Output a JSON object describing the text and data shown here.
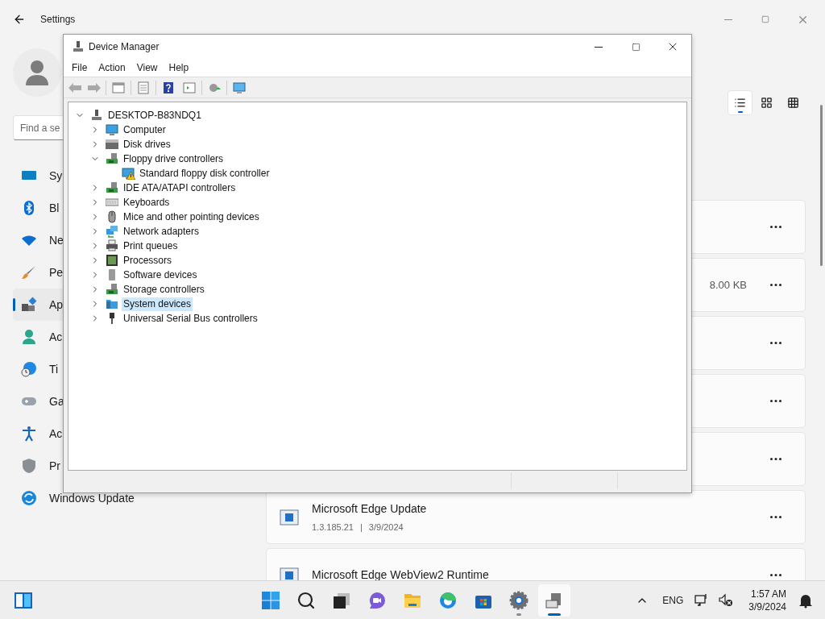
{
  "settings": {
    "title": "Settings",
    "search": {
      "placeholder": "Find a se"
    },
    "nav": [
      {
        "label": "Sy",
        "selected": false
      },
      {
        "label": "Bl",
        "selected": false
      },
      {
        "label": "Ne",
        "selected": false
      },
      {
        "label": "Pe",
        "selected": false
      },
      {
        "label": "Ap",
        "selected": true
      },
      {
        "label": "Ac",
        "selected": false
      },
      {
        "label": "Ti",
        "selected": false
      },
      {
        "label": "Ga",
        "selected": false
      },
      {
        "label": "Ac",
        "selected": false
      },
      {
        "label": "Pr",
        "selected": false
      },
      {
        "label": "Windows Update",
        "selected": false
      }
    ],
    "view_options": [
      {
        "selected": true
      },
      {
        "selected": false
      },
      {
        "selected": false
      }
    ],
    "cards": [
      {
        "kind": "hidden"
      },
      {
        "kind": "hidden",
        "size": "8.00 KB"
      },
      {
        "kind": "hidden"
      },
      {
        "kind": "hidden"
      },
      {
        "kind": "hidden"
      },
      {
        "kind": "app",
        "title": "Microsoft Edge Update",
        "version": "1.3.185.21",
        "separator": "|",
        "date": "3/9/2024"
      },
      {
        "kind": "app",
        "title": "Microsoft Edge WebView2 Runtime"
      }
    ]
  },
  "device_manager": {
    "title": "Device Manager",
    "menu": [
      "File",
      "Action",
      "View",
      "Help"
    ],
    "tree": {
      "label": "DESKTOP-B83NDQ1",
      "expanded": true,
      "selected": false,
      "children": [
        {
          "label": "Computer",
          "expanded": false,
          "selected": false
        },
        {
          "label": "Disk drives",
          "expanded": false,
          "selected": false
        },
        {
          "label": "Floppy drive controllers",
          "expanded": true,
          "selected": false,
          "children": [
            {
              "label": "Standard floppy disk controller",
              "warning": true,
              "selected": false
            }
          ]
        },
        {
          "label": "IDE ATA/ATAPI controllers",
          "expanded": false,
          "selected": false
        },
        {
          "label": "Keyboards",
          "expanded": false,
          "selected": false
        },
        {
          "label": "Mice and other pointing devices",
          "expanded": false,
          "selected": false
        },
        {
          "label": "Network adapters",
          "expanded": false,
          "selected": false
        },
        {
          "label": "Print queues",
          "expanded": false,
          "selected": false
        },
        {
          "label": "Processors",
          "expanded": false,
          "selected": false
        },
        {
          "label": "Software devices",
          "expanded": false,
          "selected": false
        },
        {
          "label": "Storage controllers",
          "expanded": false,
          "selected": false
        },
        {
          "label": "System devices",
          "expanded": false,
          "selected": true
        },
        {
          "label": "Universal Serial Bus controllers",
          "expanded": false,
          "selected": false
        }
      ]
    }
  },
  "taskbar": {
    "apps": [
      {
        "running": false,
        "active": false
      },
      {
        "running": false,
        "active": false
      },
      {
        "running": false,
        "active": false
      },
      {
        "running": false,
        "active": false
      },
      {
        "running": false,
        "active": false
      },
      {
        "running": false,
        "active": false
      },
      {
        "running": false,
        "active": false
      },
      {
        "running": true,
        "active": false
      },
      {
        "running": true,
        "active": true
      }
    ],
    "language": "ENG",
    "time": "1:57 AM",
    "date": "3/9/2024"
  }
}
